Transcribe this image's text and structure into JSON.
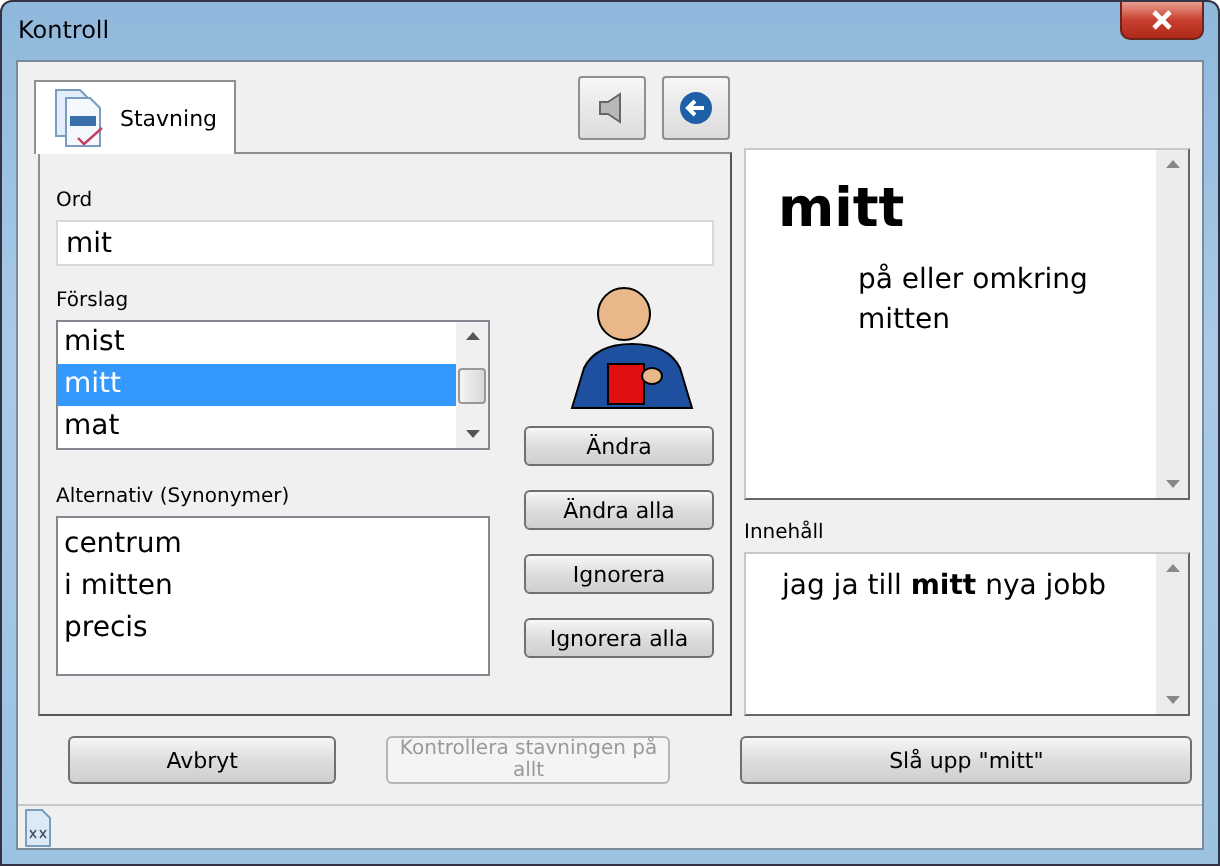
{
  "window": {
    "title": "Kontroll"
  },
  "tabs": [
    {
      "label": "Stavning",
      "selected": true
    }
  ],
  "word": {
    "label": "Ord",
    "value": "mit"
  },
  "suggestions": {
    "label": "Förslag",
    "items": [
      {
        "text": "mist",
        "selected": false
      },
      {
        "text": "mitt",
        "selected": true
      },
      {
        "text": "mat",
        "selected": false
      }
    ]
  },
  "alternatives": {
    "label": "Alternativ (Synonymer)",
    "items": [
      "centrum",
      "i mitten",
      "precis"
    ]
  },
  "actions": [
    {
      "label": "Ändra",
      "disabled": false
    },
    {
      "label": "Ändra alla",
      "disabled": false
    },
    {
      "label": "Ignorera",
      "disabled": false
    },
    {
      "label": "Ignorera alla",
      "disabled": false
    }
  ],
  "definition": {
    "headword": "mitt",
    "text": "på eller omkring mitten"
  },
  "context": {
    "label": "Innehåll",
    "text": "jag ja till **mitt** nya jobb"
  },
  "footer_buttons": [
    {
      "label": "Avbryt",
      "disabled": false
    },
    {
      "label": "Kontrollera stavningen på allt",
      "disabled": true
    },
    {
      "label": "Slå upp \"mitt\"",
      "disabled": false
    }
  ]
}
